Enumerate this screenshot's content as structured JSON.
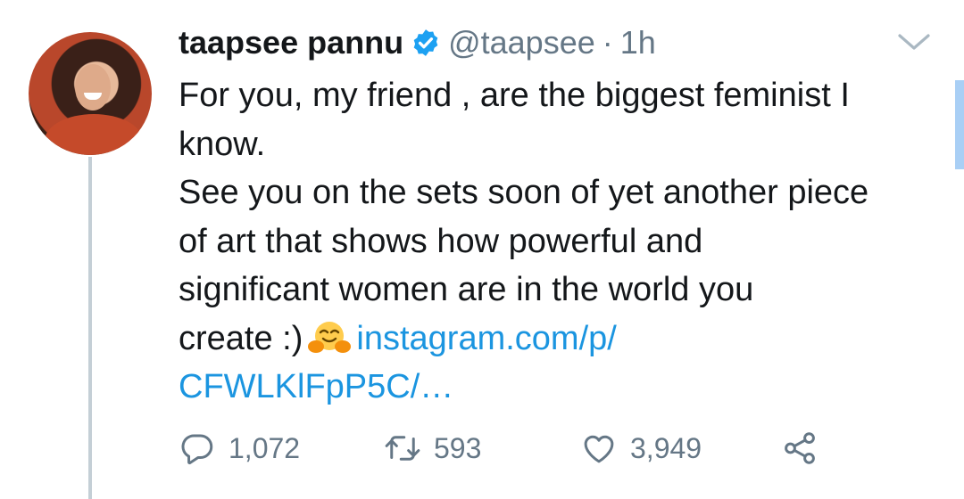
{
  "tweet": {
    "author_name": "taapsee pannu",
    "handle": "@taapsee",
    "separator": "·",
    "timestamp": "1h",
    "text_line1": "For you, my friend , are the biggest feminist I",
    "text_line2": "know.",
    "text_line3": "See you on the sets soon of yet another piece",
    "text_line4": "of art that shows how powerful and",
    "text_line5": "significant women are in the world you",
    "text_line6_prefix": "create :)",
    "emoji": "🤗",
    "link_part1": "instagram.com/p/",
    "link_part2": "CFWLKlFpP5C/…"
  },
  "actions": {
    "replies": "1,072",
    "retweets": "593",
    "likes": "3,949"
  },
  "icons": {
    "verified": "verified-badge-icon",
    "menu": "chevron-down-icon",
    "reply": "reply-icon",
    "retweet": "retweet-icon",
    "like": "heart-icon",
    "share": "share-icon"
  },
  "colors": {
    "link": "#1b95e0",
    "secondary_text": "#657786",
    "verified_badge": "#1da1f2"
  }
}
